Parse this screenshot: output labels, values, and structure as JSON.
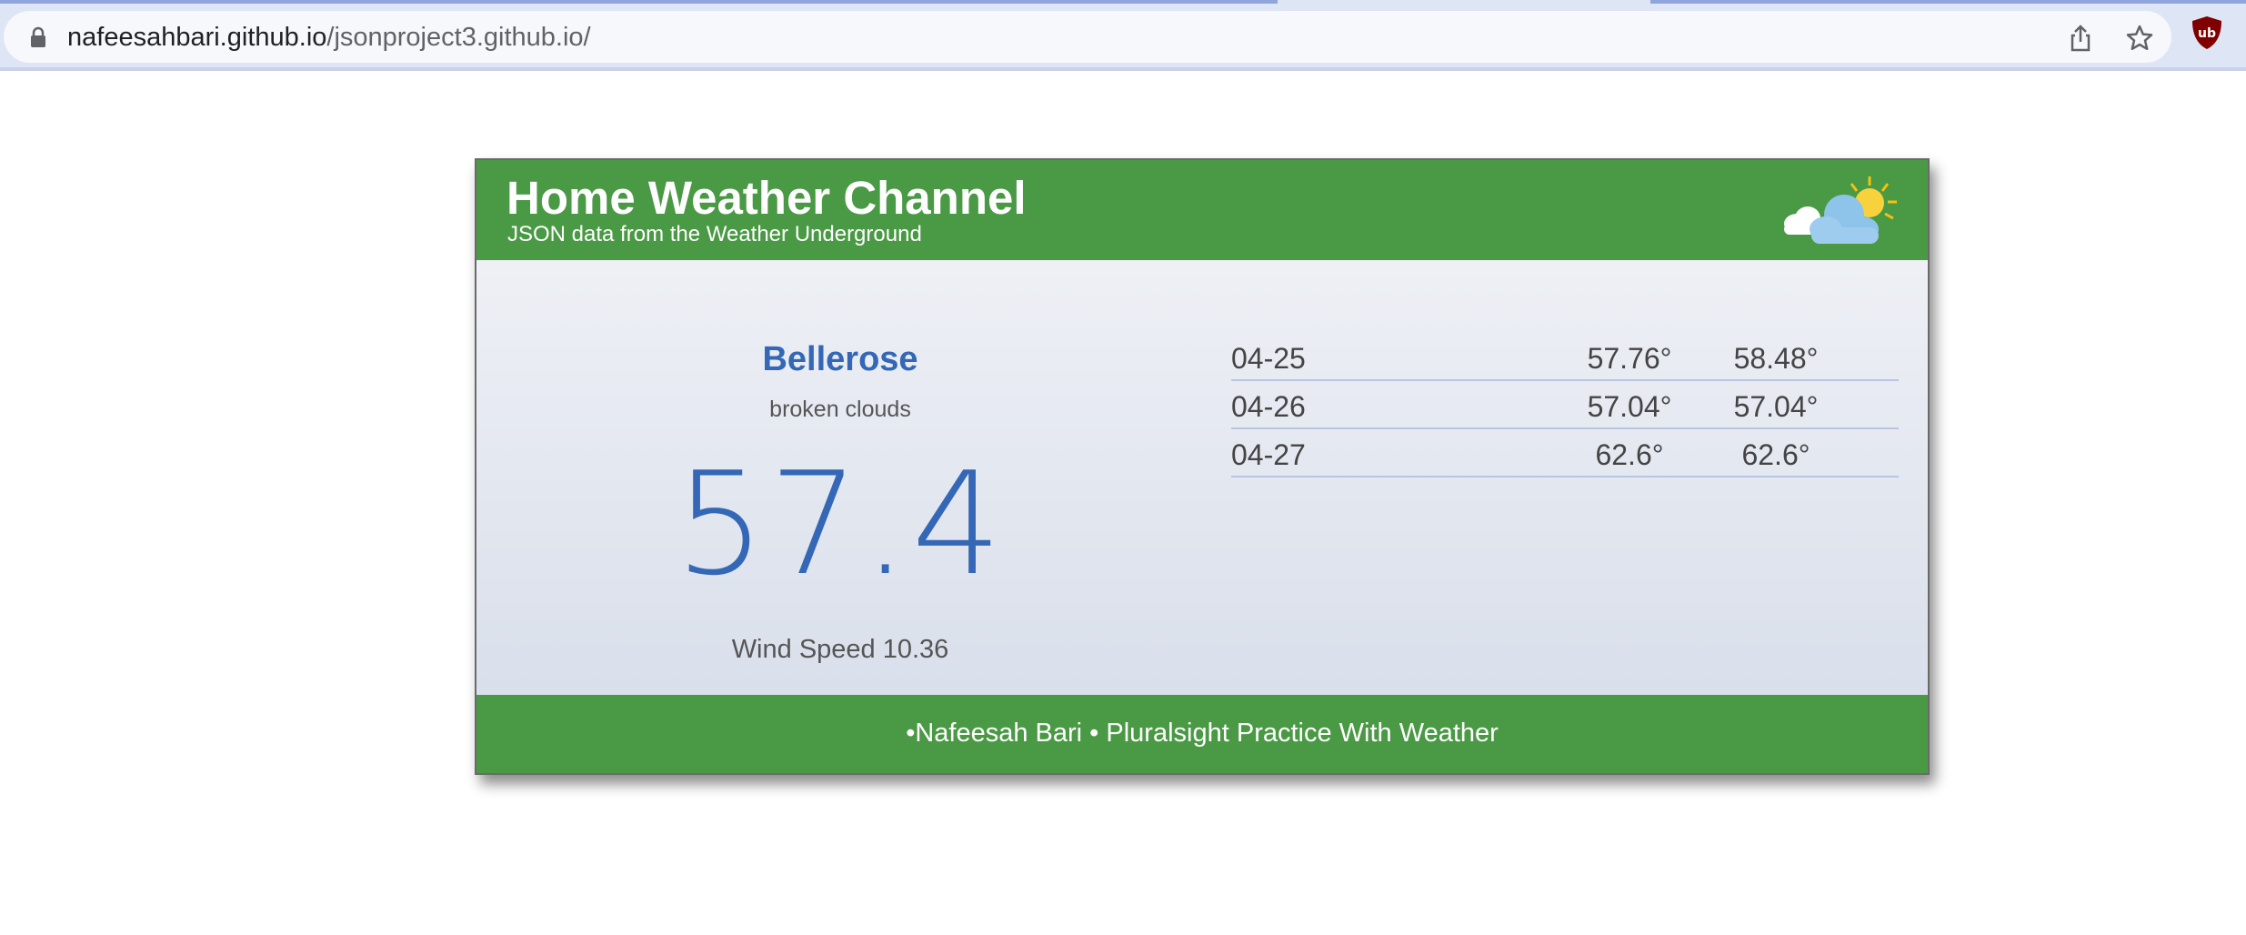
{
  "browser": {
    "url_host": "nafeesahbari.github.io",
    "url_path": "/jsonproject3.github.io/",
    "icons": [
      "lock-icon",
      "share-icon",
      "star-icon",
      "ublock-icon"
    ],
    "colors": {
      "chrome": "#dee5f5",
      "addressbar": "#f7f8fb"
    }
  },
  "header": {
    "title": "Home Weather Channel",
    "subtitle": "JSON data from the Weather Underground",
    "logo_icon": "partly-cloudy-icon"
  },
  "current": {
    "city": "Bellerose",
    "conditions": "broken clouds",
    "temperature": "57.4",
    "wind": "Wind Speed 10.36"
  },
  "forecast": [
    {
      "date": "04-25",
      "low": "57.76°",
      "high": "58.48°"
    },
    {
      "date": "04-26",
      "low": "57.04°",
      "high": "57.04°"
    },
    {
      "date": "04-27",
      "low": "62.6°",
      "high": "62.6°"
    }
  ],
  "footer": {
    "text": "•Nafeesah Bari • Pluralsight Practice With Weather"
  },
  "colors": {
    "brand_green": "#4a9944",
    "accent_blue": "#3467b5"
  }
}
